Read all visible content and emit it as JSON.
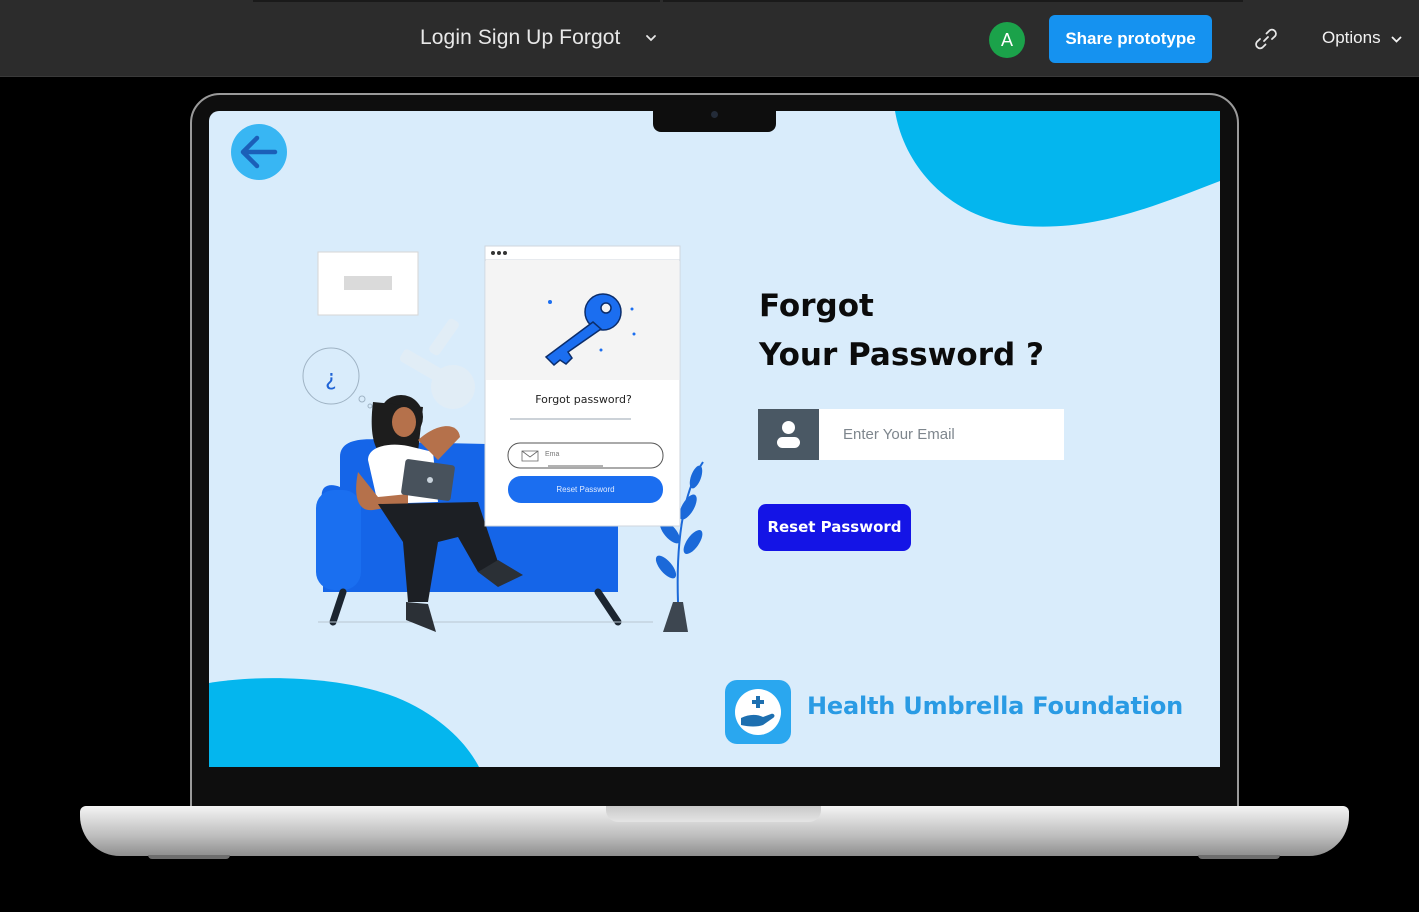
{
  "toolbar": {
    "prototype_title": "Login Sign Up Forgot",
    "avatar_initial": "A",
    "share_label": "Share prototype",
    "options_label": "Options",
    "icons": [
      "chevron-down-icon",
      "link-icon",
      "chevron-down-icon"
    ]
  },
  "screen": {
    "back_icon": "arrow-left-icon",
    "heading_line1": "Forgot",
    "heading_line2": "Your Password ?",
    "email_placeholder": "Enter Your Email",
    "email_value": "",
    "reset_button": "Reset Password",
    "brand_name": "Health Umbrella Foundation",
    "illustration": {
      "card_title": "Forgot password?",
      "card_email_placeholder": "Ema",
      "card_reset_label": "Reset Password"
    }
  },
  "colors": {
    "accent": "#1592f0",
    "screen_bg": "#d9ecfb",
    "blob": "#04b6ee",
    "reset_button": "#1414e6",
    "brand_text": "#2a9be4"
  }
}
